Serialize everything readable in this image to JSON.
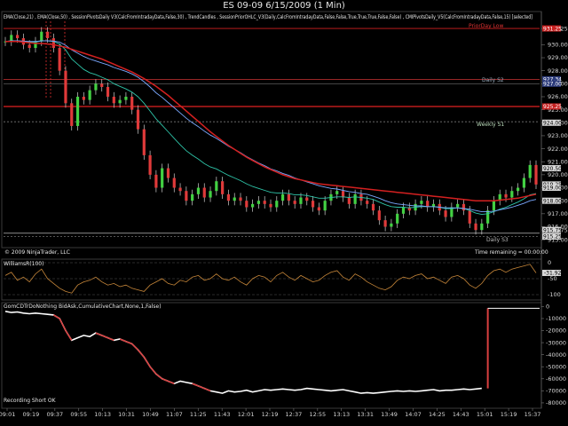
{
  "window": {
    "title": "ES 09-09  6/15/2009 (1 Min)"
  },
  "indicators_line": "EMA(Close,21) , EMA(Close,50) , SessionPivotsDaily V3(CalcFromIntradayData,False,30) , TrendCandles , SessionPriorOHLC_V3(Daily,CalcFromIntradayData,False,False,True,True,True,False,False) , CMIPivotsDaily_V5(CalcFromIntradayData,False,15) [selected]",
  "copyright": "© 2009 NinjaTrader, LLC",
  "time_remaining": "Time remaining = 00:00:00",
  "level_labels": {
    "prior_day_low": "PriorDay Low",
    "daily_s2": "Daily S2",
    "weekly_s1": "Weekly S1",
    "daily_s3": "Daily S3"
  },
  "williams_label": "WilliamsR(100)",
  "gom_label": "GomCDTrDoNothing BidAsk,CumulativeChart,None,1,False)",
  "recording": "Recording Short OK",
  "colors": {
    "price_line": "#e8e8e8",
    "ema21": "#2ec4a8",
    "ema50": "#7aa8ff",
    "ema200": "#d42020",
    "up_candle": "#43d143",
    "down_candle": "#e03a3a",
    "williams": "#c9883a",
    "delta_line": "#ffffff",
    "delta_spike": "#d94040"
  },
  "chart_data": [
    {
      "type": "line",
      "panel": "price",
      "y_ticks": [
        "931.25",
        "930.00",
        "929.00",
        "928.00",
        "927.00",
        "926.00",
        "925.00",
        "924.00",
        "923.00",
        "922.00",
        "921.00",
        "920.00",
        "919.00",
        "918.00",
        "917.00",
        "916.00",
        "915.75",
        "915.00"
      ],
      "ylim": [
        914.6,
        931.8
      ],
      "level_values": {
        "prior_day_low": 931.25,
        "daily_s2": 927.34,
        "daily_s2_b": 927.0,
        "pivot_d": 925.25,
        "weekly_s1": 924.08,
        "daily_s3": 915.25,
        "low_line": 915.5
      },
      "axis_badges": [
        "931.25",
        "927.34",
        "927.00",
        "925.25",
        "924.00",
        "920.50",
        "919.25",
        "919.00",
        "918.00",
        "915.75",
        "915.25"
      ],
      "x_labels": [
        "09:01",
        "09:19",
        "09:37",
        "09:55",
        "10:13",
        "10:31",
        "10:49",
        "11:07",
        "11:25",
        "11:43",
        "12:01",
        "12:19",
        "12:37",
        "12:55",
        "13:13",
        "13:31",
        "13:49",
        "14:07",
        "14:25",
        "14:43",
        "15:01",
        "15:19",
        "15:37"
      ],
      "series": [
        {
          "name": "Close",
          "values": [
            930.25,
            930.75,
            930.5,
            930,
            929.75,
            930.25,
            931,
            930.5,
            929.75,
            928,
            925.5,
            923.75,
            926,
            925.75,
            926.5,
            927,
            926.75,
            926,
            925.5,
            925.75,
            926,
            925,
            923.5,
            921.5,
            920,
            919,
            920.5,
            919.75,
            919,
            918.75,
            918,
            918.5,
            919,
            918.25,
            918.75,
            919.5,
            918.5,
            918,
            918.25,
            918,
            917.5,
            917.75,
            918,
            917.75,
            917.5,
            918,
            918.5,
            918,
            917.75,
            918.25,
            918,
            917.5,
            917.25,
            918,
            918.5,
            918.75,
            918.25,
            917.75,
            918.5,
            918,
            917.75,
            917.25,
            916.5,
            916,
            916.25,
            917,
            917.5,
            917.25,
            917.75,
            918,
            917.5,
            917.75,
            917.25,
            916.75,
            917.5,
            917.75,
            917.25,
            916.25,
            915.75,
            916.25,
            917.25,
            918,
            918.5,
            918.25,
            918.75,
            919,
            919.75,
            920.75,
            919.25
          ]
        },
        {
          "name": "EMA(Close,21)",
          "values": [
            930.25,
            930.3,
            930.3,
            930.25,
            930.2,
            930.2,
            930.3,
            930.3,
            930.25,
            930.05,
            929.6,
            928.9,
            928.5,
            928.1,
            927.85,
            927.7,
            927.5,
            927.3,
            927,
            926.8,
            926.6,
            926.35,
            926,
            925.5,
            924.9,
            924.3,
            923.8,
            923.3,
            922.8,
            922.3,
            921.85,
            921.5,
            921.2,
            920.85,
            920.6,
            920.45,
            920.2,
            919.95,
            919.75,
            919.55,
            919.3,
            919.1,
            918.95,
            918.8,
            918.65,
            918.6,
            918.6,
            918.55,
            918.45,
            918.45,
            918.4,
            918.3,
            918.2,
            918.2,
            918.25,
            918.3,
            918.3,
            918.25,
            918.3,
            918.25,
            918.2,
            918.1,
            917.9,
            917.7,
            917.55,
            917.5,
            917.5,
            917.45,
            917.5,
            917.55,
            917.55,
            917.55,
            917.5,
            917.4,
            917.4,
            917.45,
            917.4,
            917.25,
            917.05,
            916.95,
            917,
            917.15,
            917.35,
            917.5,
            917.7,
            917.9,
            918.15,
            918.45,
            918.55
          ]
        },
        {
          "name": "EMA(Close,50)",
          "values": [
            930.25,
            930.3,
            930.3,
            930.28,
            930.25,
            930.25,
            930.3,
            930.3,
            930.28,
            930.2,
            929.95,
            929.6,
            929.35,
            929.1,
            928.9,
            928.75,
            928.6,
            928.45,
            928.25,
            928.1,
            927.95,
            927.75,
            927.5,
            927.15,
            926.75,
            926.3,
            925.95,
            925.55,
            925.15,
            924.75,
            924.35,
            924,
            923.7,
            923.35,
            923.05,
            922.8,
            922.5,
            922.2,
            921.95,
            921.7,
            921.4,
            921.15,
            920.9,
            920.7,
            920.45,
            920.3,
            920.1,
            919.95,
            919.75,
            919.6,
            919.45,
            919.3,
            919.15,
            919.05,
            918.95,
            918.9,
            918.8,
            918.7,
            918.65,
            918.55,
            918.5,
            918.35,
            918.2,
            918,
            917.85,
            917.75,
            917.7,
            917.65,
            917.6,
            917.6,
            917.55,
            917.55,
            917.5,
            917.45,
            917.45,
            917.45,
            917.4,
            917.35,
            917.25,
            917.15,
            917.15,
            917.2,
            917.3,
            917.4,
            917.5,
            917.65,
            917.8,
            918,
            918.1
          ]
        },
        {
          "name": "EMA(Close,200)",
          "values": [
            930.25,
            930.25,
            930.25,
            930.2,
            930.15,
            930.1,
            930.1,
            930.05,
            930,
            929.9,
            929.8,
            929.65,
            929.5,
            929.35,
            929.2,
            929.05,
            928.9,
            928.7,
            928.5,
            928.3,
            928.1,
            927.9,
            927.65,
            927.4,
            927.1,
            926.8,
            926.45,
            926.1,
            925.7,
            925.3,
            924.9,
            924.5,
            924.1,
            923.7,
            923.3,
            922.95,
            922.6,
            922.25,
            921.95,
            921.65,
            921.35,
            921.1,
            920.85,
            920.6,
            920.4,
            920.2,
            920,
            919.85,
            919.7,
            919.6,
            919.5,
            919.4,
            919.3,
            919.25,
            919.2,
            919.15,
            919.1,
            919.05,
            919,
            918.95,
            918.9,
            918.85,
            918.8,
            918.75,
            918.7,
            918.65,
            918.6,
            918.55,
            918.5,
            918.45,
            918.4,
            918.35,
            918.3,
            918.25,
            918.2,
            918.15,
            918.1,
            918.05,
            918,
            918,
            918,
            918,
            918.05,
            918.1,
            918.15,
            918.2,
            918.3,
            918.4,
            918.5
          ]
        }
      ]
    },
    {
      "type": "line",
      "panel": "williams",
      "title": "WilliamsR(100)",
      "y_ticks": [
        "0",
        "-31.92",
        "-50",
        "-100"
      ],
      "ylim": [
        -100,
        0
      ],
      "series": [
        {
          "name": "WilliamsR(100)",
          "values": [
            -40,
            -30,
            -55,
            -45,
            -60,
            -35,
            -20,
            -50,
            -65,
            -80,
            -90,
            -95,
            -70,
            -60,
            -55,
            -45,
            -60,
            -70,
            -65,
            -75,
            -70,
            -80,
            -85,
            -90,
            -70,
            -60,
            -50,
            -65,
            -70,
            -55,
            -60,
            -45,
            -40,
            -55,
            -50,
            -35,
            -50,
            -55,
            -45,
            -60,
            -70,
            -50,
            -40,
            -45,
            -60,
            -40,
            -30,
            -45,
            -55,
            -40,
            -50,
            -60,
            -55,
            -40,
            -30,
            -25,
            -45,
            -55,
            -35,
            -45,
            -60,
            -70,
            -80,
            -85,
            -75,
            -55,
            -45,
            -50,
            -40,
            -35,
            -50,
            -45,
            -55,
            -65,
            -45,
            -40,
            -50,
            -70,
            -80,
            -65,
            -40,
            -25,
            -20,
            -30,
            -20,
            -15,
            -10,
            -5,
            -31.92
          ]
        }
      ]
    },
    {
      "type": "line",
      "panel": "delta",
      "title": "GomCDTrDoNothing BidAsk,CumulativeChart,None,1,False)",
      "y_ticks": [
        "0",
        "-10000",
        "-20000",
        "-30000",
        "-40000",
        "-50000",
        "-60000",
        "-70000",
        "-80000"
      ],
      "ylim": [
        -83000,
        1000
      ],
      "series": [
        {
          "name": "Cumulative Delta",
          "values": [
            -4000,
            -5000,
            -4500,
            -5500,
            -6000,
            -5500,
            -6000,
            -6500,
            -7000,
            -10000,
            -20000,
            -28000,
            -26000,
            -24000,
            -25000,
            -22000,
            -24000,
            -26000,
            -28000,
            -27000,
            -29000,
            -31000,
            -36000,
            -42000,
            -50000,
            -56000,
            -60000,
            -62000,
            -64000,
            -62000,
            -63000,
            -64000,
            -66000,
            -68000,
            -70000,
            -71000,
            -72000,
            -70000,
            -71000,
            -70500,
            -69500,
            -71000,
            -70000,
            -69000,
            -69500,
            -69000,
            -68500,
            -69000,
            -69500,
            -69000,
            -68000,
            -68500,
            -69000,
            -69500,
            -70000,
            -69500,
            -69000,
            -70000,
            -71000,
            -72000,
            -71500,
            -72000,
            -71500,
            -71000,
            -70500,
            -70000,
            -70500,
            -70000,
            -70500,
            -70000,
            -69500,
            -69000,
            -70000,
            -69500,
            -69500,
            -69000,
            -68500,
            -69000,
            -68500,
            -68000,
            -1500,
            -1500,
            -1500,
            -1500,
            -1500,
            -1500,
            -1500,
            -1500,
            -1500
          ]
        }
      ]
    }
  ]
}
